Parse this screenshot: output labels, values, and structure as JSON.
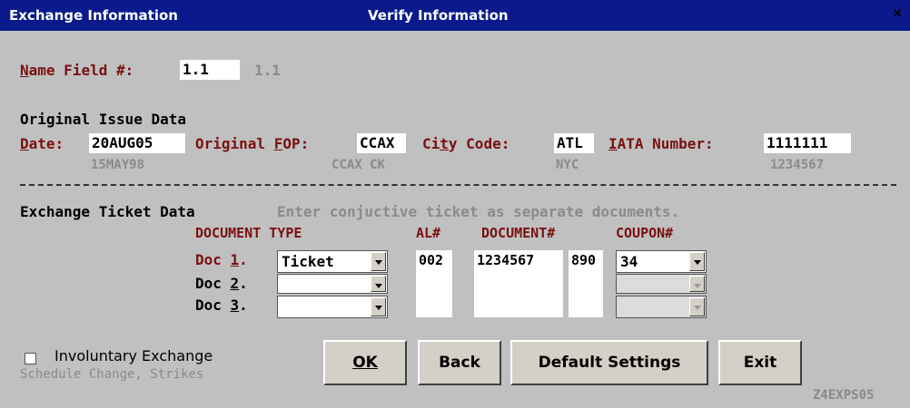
{
  "window": {
    "title_left": "Exchange Information",
    "title_center": "Verify Information",
    "close_glyph": "×"
  },
  "name_field": {
    "label": "Name Field #:",
    "value": "1.1",
    "original": "1.1"
  },
  "original_issue": {
    "heading": "Original Issue Data",
    "date": {
      "label": "Date:",
      "value": "20AUG05",
      "original": "15MAY98"
    },
    "fop": {
      "label": "Original FOP:",
      "value": "CCAX",
      "original": "CCAX CK"
    },
    "city": {
      "label": "City Code:",
      "value": "ATL",
      "original": "NYC"
    },
    "iata": {
      "label": "IATA Number:",
      "value": "1111111",
      "original": "1234567"
    }
  },
  "exchange": {
    "heading": "Exchange Ticket Data",
    "hint": "Enter conjuctive ticket as separate documents.",
    "columns": {
      "doc_type": "DOCUMENT TYPE",
      "al": "AL#",
      "document": "DOCUMENT#",
      "coupon": "COUPON#"
    },
    "docs": [
      {
        "label": "Doc 1.",
        "type": "Ticket",
        "al": "002",
        "document": "1234567",
        "doc2": "890",
        "coupon": "34"
      },
      {
        "label": "Doc 2.",
        "type": "",
        "al": "",
        "document": "",
        "doc2": "",
        "coupon": ""
      },
      {
        "label": "Doc 3.",
        "type": "",
        "al": "",
        "document": "",
        "doc2": "",
        "coupon": ""
      }
    ]
  },
  "involuntary": {
    "label": "Involuntary Exchange",
    "sub": "Schedule Change, Strikes",
    "checked": false
  },
  "buttons": {
    "ok": "OK",
    "back": "Back",
    "default": "Default Settings",
    "exit": "Exit"
  },
  "screen_id": "Z4EXPS05"
}
